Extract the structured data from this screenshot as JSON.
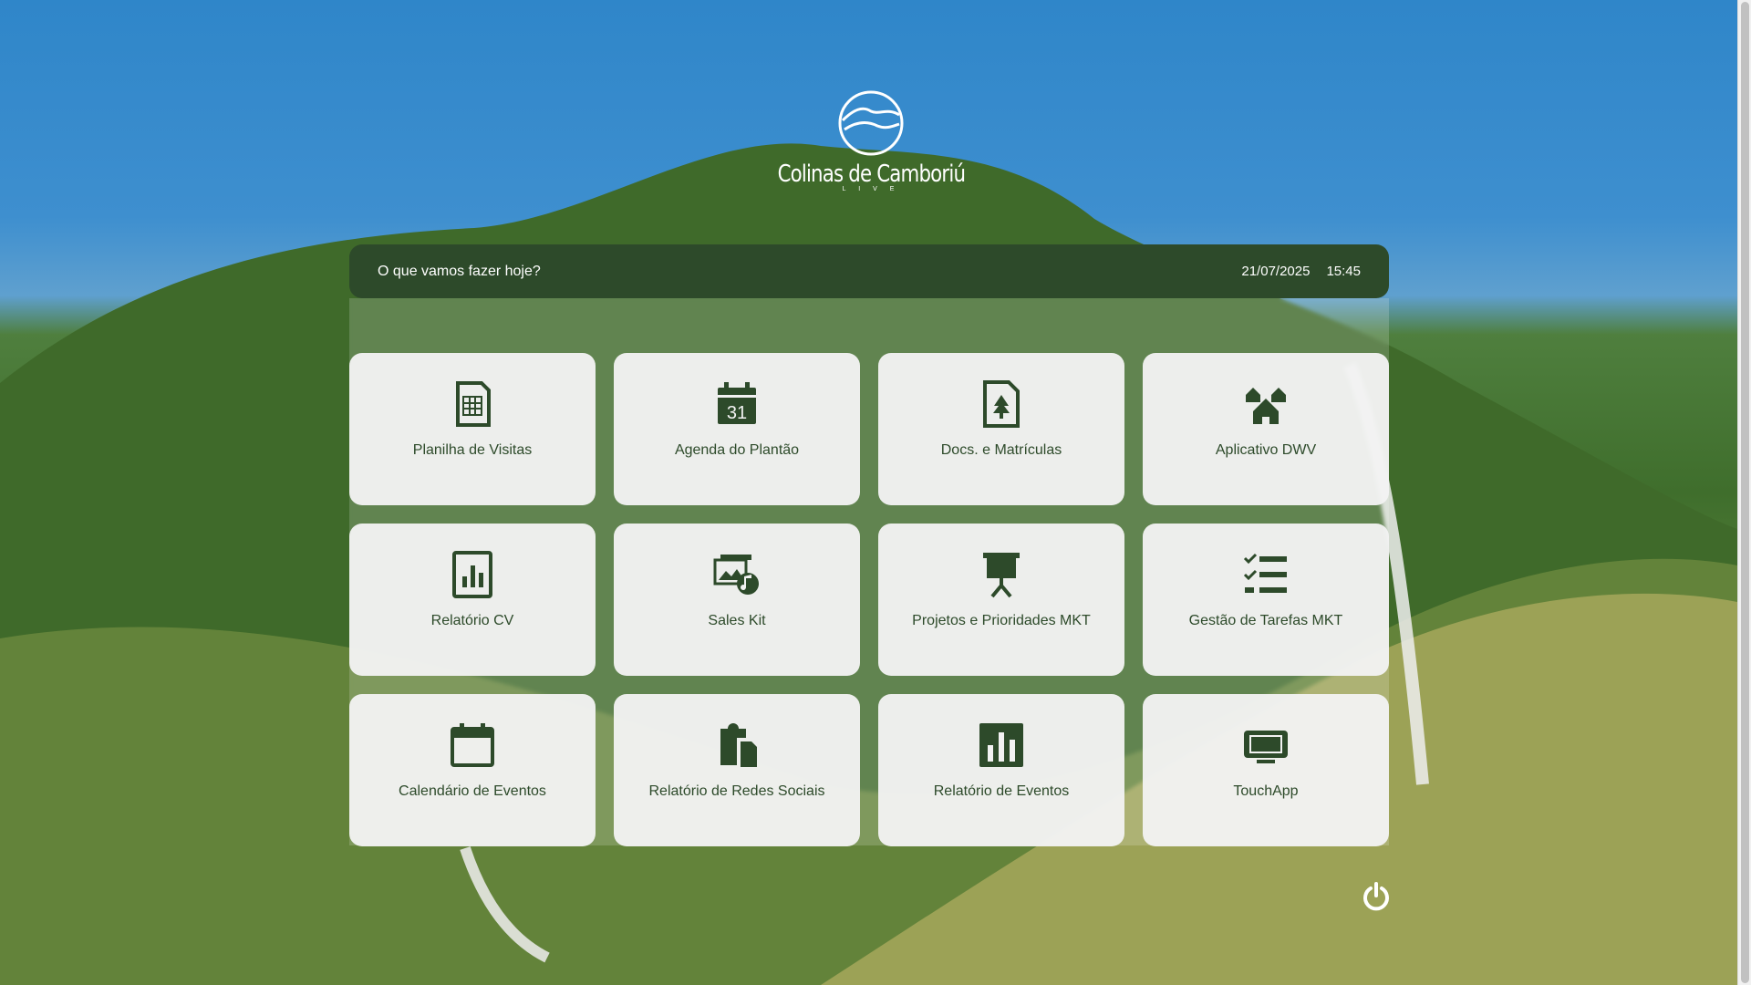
{
  "logo": {
    "name": "Colinas de Camboriú",
    "tagline": "L I V E"
  },
  "header": {
    "greeting": "O que vamos fazer hoje?",
    "date": "21/07/2025",
    "time": "15:45"
  },
  "tiles": [
    {
      "label": "Planilha de Visitas",
      "icon": "spreadsheet-icon"
    },
    {
      "label": "Agenda do Plantão",
      "icon": "calendar-31-icon"
    },
    {
      "label": "Docs. e Matrículas",
      "icon": "document-tree-icon"
    },
    {
      "label": "Aplicativo DWV",
      "icon": "houses-icon"
    },
    {
      "label": "Relatório CV",
      "icon": "report-chart-icon"
    },
    {
      "label": "Sales Kit",
      "icon": "media-icon"
    },
    {
      "label": "Projetos e Prioridades MKT",
      "icon": "presentation-icon"
    },
    {
      "label": "Gestão de Tarefas MKT",
      "icon": "checklist-icon"
    },
    {
      "label": "Calendário de Eventos",
      "icon": "calendar-icon"
    },
    {
      "label": "Relatório de Redes Sociais",
      "icon": "clipboard-files-icon"
    },
    {
      "label": "Relatório de Eventos",
      "icon": "bar-chart-icon"
    },
    {
      "label": "TouchApp",
      "icon": "monitor-icon"
    }
  ],
  "colors": {
    "accent": "#2d4a2a",
    "tile_bg": "#f2f2f2",
    "sky": "#2f86c9"
  }
}
